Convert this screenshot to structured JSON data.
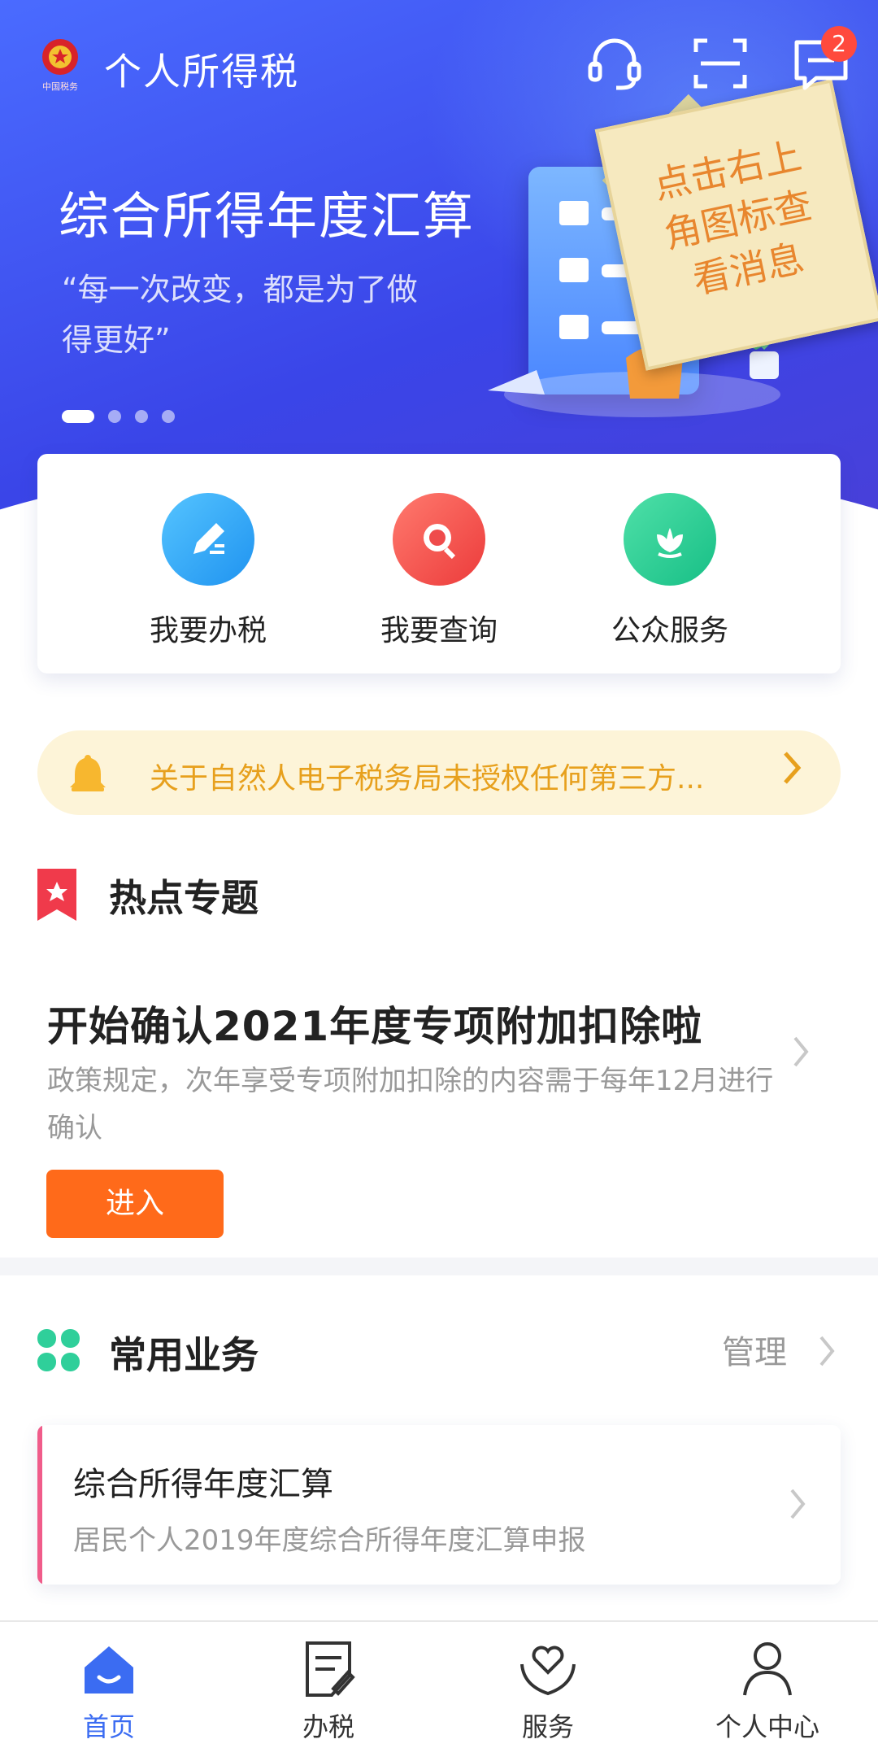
{
  "header": {
    "app_title": "个人所得税",
    "logo_caption": "中国税务",
    "icons": [
      "headset-icon",
      "scan-icon",
      "message-icon"
    ],
    "message_badge": "2"
  },
  "banner": {
    "title": "综合所得年度汇算",
    "subtitle": "“每一次改变，都是为了做得更好”",
    "sticky_note": "点击右上角图标查看消息",
    "slide_count": 4,
    "active_slide": 1
  },
  "quick_actions": [
    {
      "label": "我要办税",
      "icon": "edit-icon",
      "color": "#2aa8f5"
    },
    {
      "label": "我要查询",
      "icon": "search-icon",
      "color": "#f25151"
    },
    {
      "label": "公众服务",
      "icon": "flower-icon",
      "color": "#2fcf9a"
    }
  ],
  "notice": {
    "text": "关于自然人电子税务局未授权任何第三方...",
    "icon": "bell-icon"
  },
  "hot_topics": {
    "section_title": "热点专题",
    "title": "开始确认2021年度专项附加扣除啦",
    "description": "政策规定，次年享受专项附加扣除的内容需于每年12月进行确认",
    "button_label": "进入"
  },
  "common_business": {
    "section_title": "常用业务",
    "manage_label": "管理",
    "items": [
      {
        "title": "综合所得年度汇算",
        "subtitle": "居民个人2019年度综合所得年度汇算申报"
      }
    ]
  },
  "bottom_nav": [
    {
      "label": "首页",
      "icon": "home-icon",
      "active": true
    },
    {
      "label": "办税",
      "icon": "document-icon",
      "active": false
    },
    {
      "label": "服务",
      "icon": "heart-hands-icon",
      "active": false
    },
    {
      "label": "个人中心",
      "icon": "user-icon",
      "active": false
    }
  ],
  "colors": {
    "primary": "#3b6cf2",
    "accent_orange": "#ff6a1a",
    "notice_text": "#e7a01d",
    "badge_red": "#ff4a3d"
  }
}
